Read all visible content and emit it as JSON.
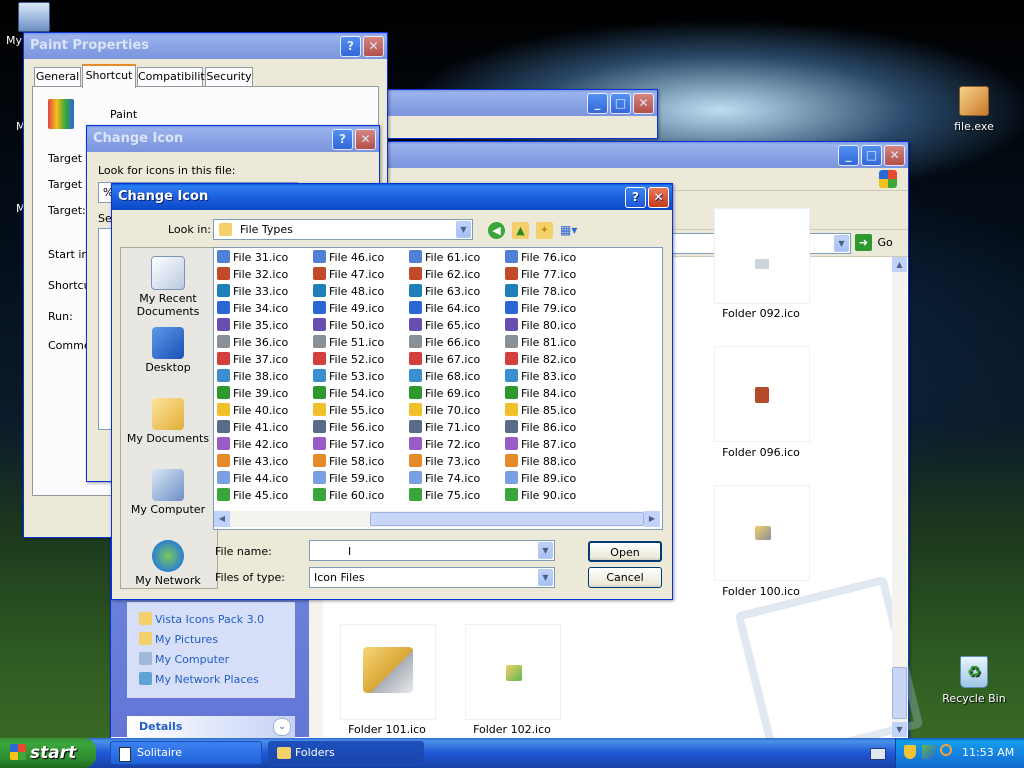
{
  "desktop": {
    "icons": [
      {
        "label": "My",
        "icon": "my-computer-icon"
      },
      {
        "label": "file.exe",
        "icon": "exe-icon"
      },
      {
        "label": "Recycle Bin",
        "icon": "recycle-bin-icon"
      }
    ],
    "partial_labels": [
      "M",
      "M"
    ]
  },
  "paint_properties": {
    "title": "Paint Properties",
    "tabs": [
      "General",
      "Shortcut",
      "Compatibility",
      "Security"
    ],
    "active_tab": "Shortcut",
    "app_name": "Paint",
    "fields": [
      "Target ty",
      "Target lo",
      "Target:",
      "Start in:",
      "Shortcu",
      "Run:",
      "Commen"
    ]
  },
  "change_icon_back": {
    "title": "Change Icon",
    "look_label": "Look for icons in this file:",
    "path_value": "%",
    "select_label": "Se"
  },
  "folders_window": {
    "address_go": "Go",
    "tiles": [
      {
        "label": "Folder 092.ico",
        "icon": "folder-092-icon"
      },
      {
        "label": "Folder 096.ico",
        "icon": "folder-096-icon"
      },
      {
        "label": "Folder 100.ico",
        "icon": "folder-100-icon"
      },
      {
        "label": "Folder 101.ico",
        "icon": "folder-101-icon"
      },
      {
        "label": "Folder 102.ico",
        "icon": "folder-102-icon"
      }
    ],
    "other_places": [
      "Vista Icons Pack 3.0",
      "My Pictures",
      "My Computer",
      "My Network Places"
    ],
    "details_label": "Details"
  },
  "open_dialog": {
    "title": "Change Icon",
    "look_in_label": "Look in:",
    "look_in_value": "File Types",
    "places": [
      "My Recent Documents",
      "Desktop",
      "My Documents",
      "My Computer",
      "My Network"
    ],
    "files": [
      "File 31.ico",
      "File 32.ico",
      "File 33.ico",
      "File 34.ico",
      "File 35.ico",
      "File 36.ico",
      "File 37.ico",
      "File 38.ico",
      "File 39.ico",
      "File 40.ico",
      "File 41.ico",
      "File 42.ico",
      "File 43.ico",
      "File 44.ico",
      "File 45.ico",
      "File 46.ico",
      "File 47.ico",
      "File 48.ico",
      "File 49.ico",
      "File 50.ico",
      "File 51.ico",
      "File 52.ico",
      "File 53.ico",
      "File 54.ico",
      "File 55.ico",
      "File 56.ico",
      "File 57.ico",
      "File 58.ico",
      "File 59.ico",
      "File 60.ico",
      "File 61.ico",
      "File 62.ico",
      "File 63.ico",
      "File 64.ico",
      "File 65.ico",
      "File 66.ico",
      "File 67.ico",
      "File 68.ico",
      "File 69.ico",
      "File 70.ico",
      "File 71.ico",
      "File 72.ico",
      "File 73.ico",
      "File 74.ico",
      "File 75.ico",
      "File 76.ico",
      "File 77.ico",
      "File 78.ico",
      "File 79.ico",
      "File 80.ico",
      "File 81.ico",
      "File 82.ico",
      "File 83.ico",
      "File 84.ico",
      "File 85.ico",
      "File 86.ico",
      "File 87.ico",
      "File 88.ico",
      "File 89.ico",
      "File 90.ico"
    ],
    "file_name_label": "File name:",
    "file_name_value": "",
    "files_of_type_label": "Files of type:",
    "files_of_type_value": "Icon Files",
    "open_label": "Open",
    "cancel_label": "Cancel"
  },
  "taskbar": {
    "start_label": "start",
    "buttons": [
      {
        "label": "Solitaire",
        "icon": "solitaire-icon"
      },
      {
        "label": "Folders",
        "icon": "folder-icon"
      }
    ],
    "clock": "11:53 AM"
  },
  "colors": {
    "xp_blue": "#0a5bdb",
    "start_green": "#3ba63b",
    "dialog_face": "#ece9d8"
  }
}
